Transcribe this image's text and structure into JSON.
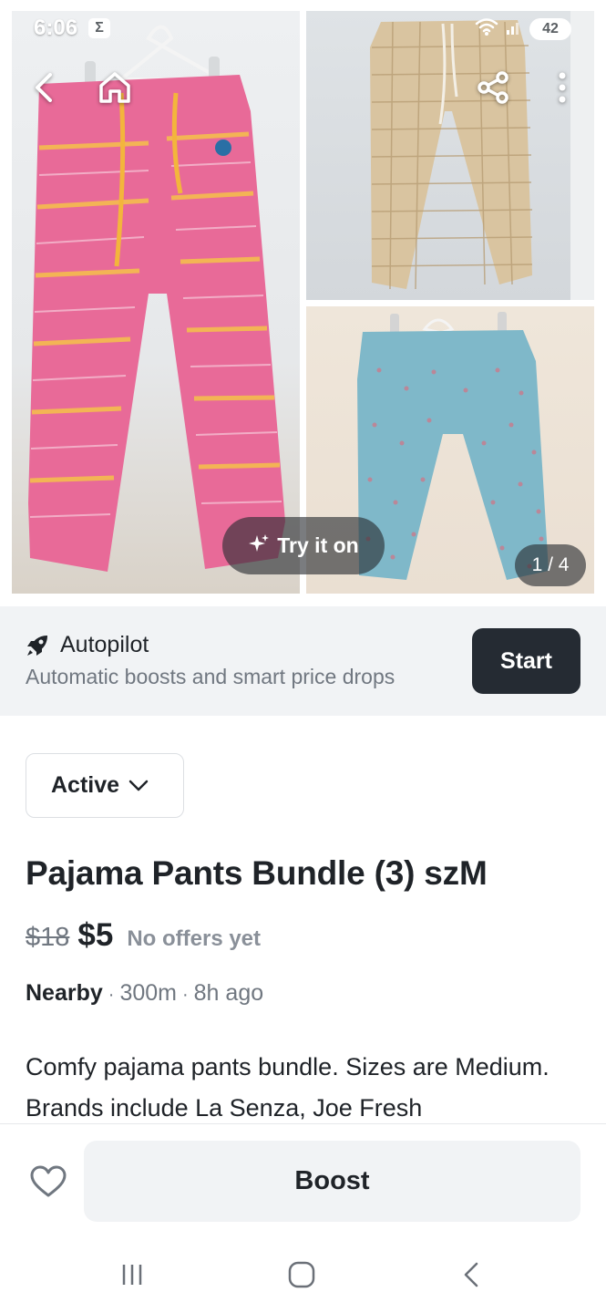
{
  "status_bar": {
    "time": "6:06",
    "notification_badge": "Σ",
    "battery": "42",
    "icons": [
      "wifi-icon",
      "signal-icon"
    ]
  },
  "gallery": {
    "photos": [
      {
        "name": "pink-pajama-pants-photo"
      },
      {
        "name": "plaid-pajama-pants-photo"
      },
      {
        "name": "blue-polka-dot-pajama-pants-photo"
      }
    ],
    "try_on_label": "Try it on",
    "counter": "1 / 4",
    "nav_icons": [
      "back-arrow-icon",
      "home-icon",
      "share-icon",
      "more-vertical-icon"
    ]
  },
  "autopilot": {
    "title": "Autopilot",
    "subtitle": "Automatic boosts and smart price drops",
    "start_label": "Start",
    "icon": "rocket-icon"
  },
  "listing": {
    "status": "Active",
    "title": "Pajama Pants Bundle (3) szM",
    "old_price": "$18",
    "price": "$5",
    "offers": "No offers yet",
    "location": "Nearby",
    "distance": "300m",
    "posted": "8h ago",
    "description": "Comfy pajama pants bundle. Sizes are Medium. Brands include La Senza, Joe Fresh"
  },
  "bottom_bar": {
    "boost_label": "Boost",
    "favorite_icon": "heart-icon"
  },
  "system_nav": {
    "icons": [
      "recent-apps-icon",
      "home-circle-icon",
      "system-back-icon"
    ]
  },
  "colors": {
    "primary_dark": "#252b33",
    "muted_text": "#707780",
    "surface": "#f1f3f5",
    "pink_pants": "#e86a98",
    "plaid_pants": "#d9c4a0",
    "blue_pants": "#7fb8c9"
  }
}
